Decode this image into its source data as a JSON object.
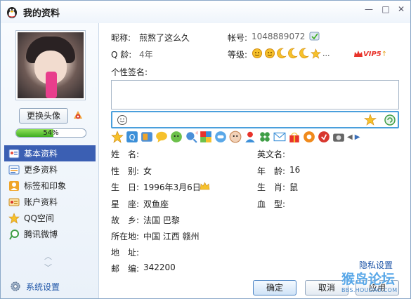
{
  "window": {
    "title": "我的资料",
    "min_symbol": "—",
    "max_symbol": "□",
    "close_symbol": "✕"
  },
  "left": {
    "change_avatar_label": "更换头像",
    "progress_label": "54%",
    "progress_value": 0.54,
    "nav": [
      {
        "label": "基本资料",
        "icon": "profile-card-icon"
      },
      {
        "label": "更多资料",
        "icon": "list-card-icon"
      },
      {
        "label": "标签和印象",
        "icon": "tag-person-icon"
      },
      {
        "label": "账户资料",
        "icon": "account-icon"
      },
      {
        "label": "QQ空间",
        "icon": "star-icon"
      },
      {
        "label": "腾讯微博",
        "icon": "weibo-icon"
      }
    ],
    "settings_label": "系统设置"
  },
  "profile": {
    "nickname_label": "昵称:",
    "nickname_value": "煎熬了这么久",
    "account_label": "帐号:",
    "account_value": "1048889072",
    "qage_label": "Q 龄:",
    "qage_value": "4年",
    "level_label": "等级:",
    "level_more": "...",
    "vip_label": "VIP5",
    "signature_label": "个性签名:",
    "fields_left": [
      {
        "label": "姓　名:",
        "value": ""
      },
      {
        "label": "性　别:",
        "value": "女"
      },
      {
        "label": "生　日:",
        "value": "1996年3月6日"
      },
      {
        "label": "星　座:",
        "value": "双鱼座"
      },
      {
        "label": "故　乡:",
        "value": "法国  巴黎"
      },
      {
        "label": "所在地:",
        "value": "中国  江西  赣州"
      },
      {
        "label": "地　址:",
        "value": ""
      },
      {
        "label": "邮　编:",
        "value": "342200"
      }
    ],
    "fields_right": [
      {
        "label": "英文名:",
        "value": ""
      },
      {
        "label": "年　龄:",
        "value": "16"
      },
      {
        "label": "生　肖:",
        "value": "鼠"
      },
      {
        "label": "血　型:",
        "value": ""
      }
    ],
    "privacy_label": "隐私设置"
  },
  "buttons": {
    "ok": "确定",
    "cancel": "取消",
    "apply": "应用"
  },
  "watermark": {
    "line1": "猴岛论坛",
    "line2": "BBS.HOUDAO.COM"
  },
  "colors": {
    "accent": "#3b5fb3",
    "link": "#1f56a8",
    "progress": "#3fae22"
  }
}
